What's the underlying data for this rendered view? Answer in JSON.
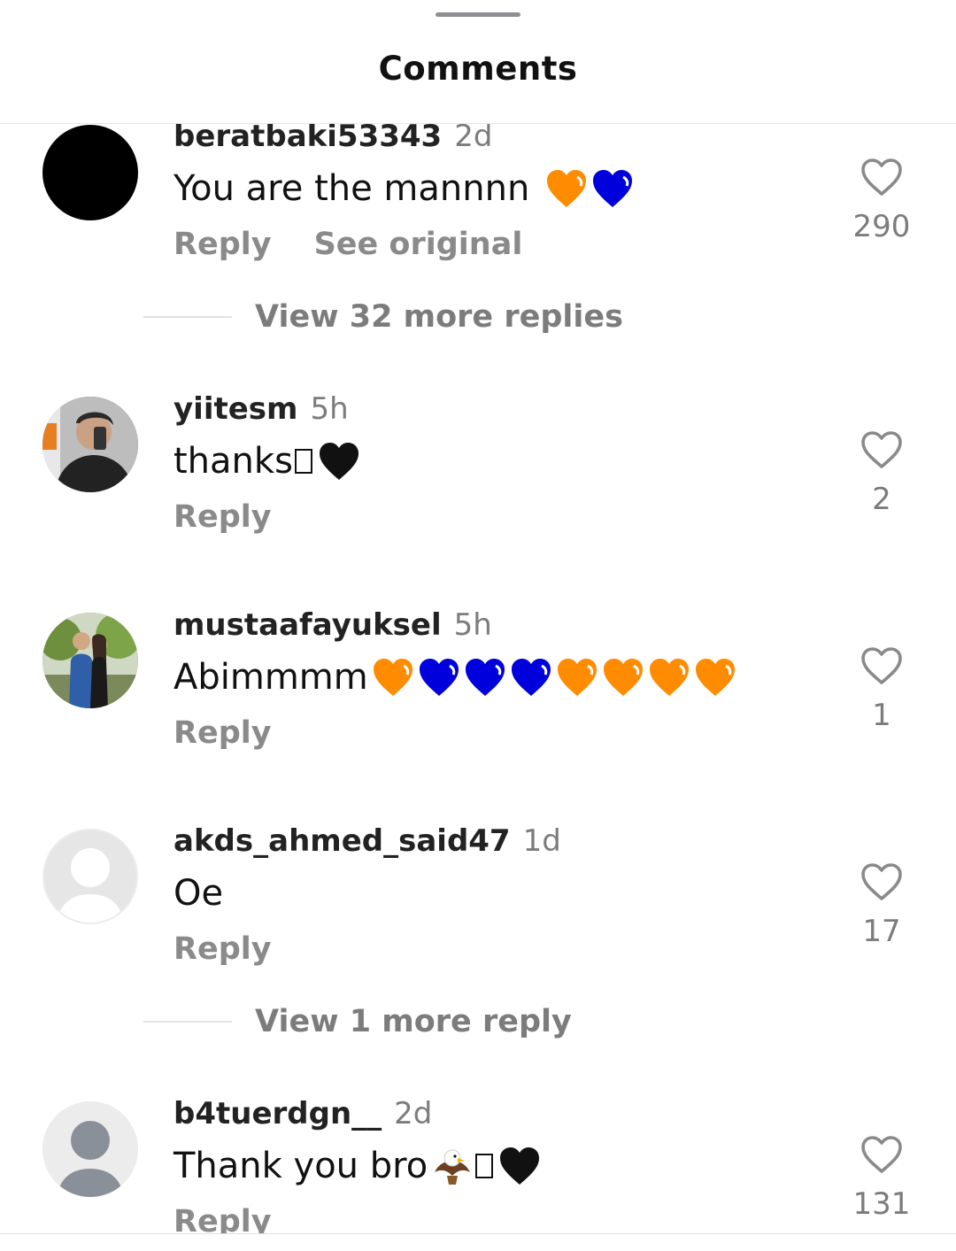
{
  "header": {
    "title": "Comments"
  },
  "colors": {
    "orange": "#ff8c00",
    "blue": "#0000dd",
    "black": "#111111",
    "secondary": "#7c7c7c"
  },
  "comments": [
    {
      "username": "beratbaki53343",
      "time": "2d",
      "text": "You are the mannnn",
      "emojis": [
        "orange-heart",
        "blue-heart"
      ],
      "reply": "Reply",
      "see_original": "See original",
      "likes": "290",
      "more_replies": "View 32 more replies"
    },
    {
      "username": "yiitesm",
      "time": "5h",
      "text": "thanks",
      "emojis": [
        "unknown-glyph",
        "black-heart"
      ],
      "reply": "Reply",
      "likes": "2"
    },
    {
      "username": "mustaafayuksel",
      "time": "5h",
      "text": "Abimmmm",
      "emojis": [
        "orange-heart",
        "blue-heart",
        "blue-heart",
        "blue-heart",
        "orange-heart",
        "orange-heart",
        "orange-heart",
        "orange-heart"
      ],
      "reply": "Reply",
      "likes": "1"
    },
    {
      "username": "akds_ahmed_said47",
      "time": "1d",
      "text": "Oe",
      "emojis": [],
      "reply": "Reply",
      "likes": "17",
      "more_replies": "View 1 more reply"
    },
    {
      "username": "b4tuerdgn__",
      "time": "2d",
      "text": "Thank you bro",
      "emojis": [
        "eagle",
        "unknown-glyph",
        "black-heart"
      ],
      "reply": "Reply",
      "likes": "131"
    }
  ]
}
